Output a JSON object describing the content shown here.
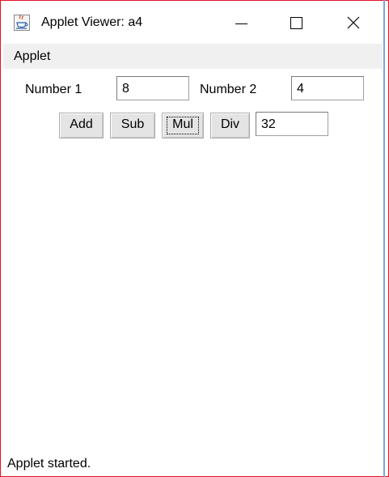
{
  "window": {
    "title": "Applet Viewer: a4",
    "app_icon": "java-icon",
    "controls": {
      "minimize_icon": "minimize-icon",
      "maximize_icon": "maximize-icon",
      "close_icon": "close-icon"
    },
    "border_color": "#e81123"
  },
  "menubar": {
    "items": [
      {
        "label": "Applet"
      }
    ]
  },
  "form": {
    "number1": {
      "label": "Number 1",
      "value": "8"
    },
    "number2": {
      "label": "Number 2",
      "value": "4"
    },
    "buttons": [
      {
        "label": "Add"
      },
      {
        "label": "Sub"
      },
      {
        "label": "Mul",
        "focused": true
      },
      {
        "label": "Div"
      }
    ],
    "result": {
      "value": "32"
    }
  },
  "status": {
    "text": "Applet started."
  }
}
